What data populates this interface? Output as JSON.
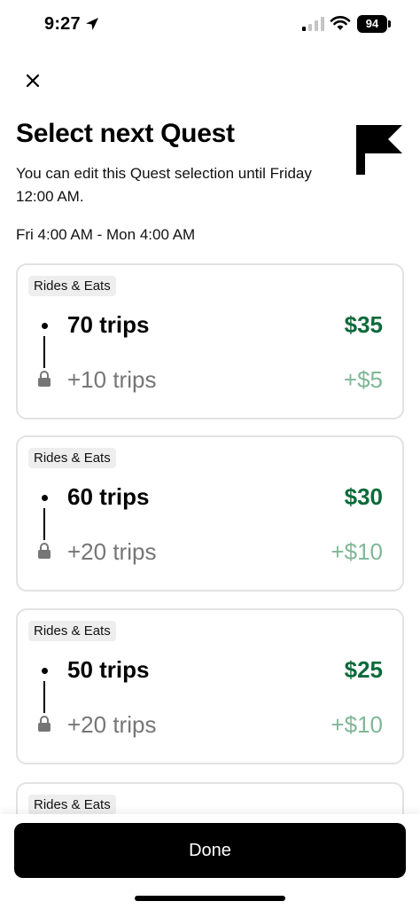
{
  "status_bar": {
    "time": "9:27",
    "battery": "94"
  },
  "header": {
    "title": "Select next Quest",
    "subtitle": "You can edit this Quest selection until Friday 12:00 AM.",
    "date_range": "Fri 4:00 AM - Mon 4:00 AM"
  },
  "quests": [
    {
      "tag": "Rides & Eats",
      "trips": "70 trips",
      "amount": "$35",
      "extra_trips": "+10 trips",
      "extra_amount": "+$5"
    },
    {
      "tag": "Rides & Eats",
      "trips": "60 trips",
      "amount": "$30",
      "extra_trips": "+20 trips",
      "extra_amount": "+$10"
    },
    {
      "tag": "Rides & Eats",
      "trips": "50 trips",
      "amount": "$25",
      "extra_trips": "+20 trips",
      "extra_amount": "+$10"
    },
    {
      "tag": "Rides & Eats"
    }
  ],
  "footer": {
    "done_label": "Done"
  },
  "colors": {
    "accent_green": "#0b6b3a",
    "muted_green": "#7fb897",
    "button_bg": "#000000"
  }
}
